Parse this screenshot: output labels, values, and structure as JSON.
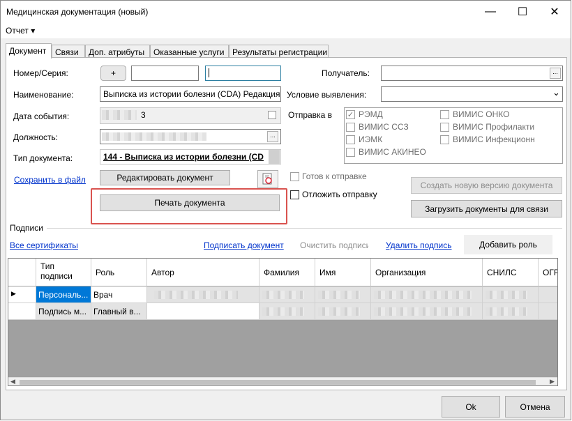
{
  "window": {
    "title": "Медицинская документация (новый)",
    "minimize": "—",
    "maximize": "☐",
    "close": "✕"
  },
  "menu": {
    "report": "Отчет ▾"
  },
  "tabs": [
    {
      "label": "Документ"
    },
    {
      "label": "Связи"
    },
    {
      "label": "Доп. атрибуты"
    },
    {
      "label": "Оказанные услуги"
    },
    {
      "label": "Результаты регистрации"
    }
  ],
  "form": {
    "number_label": "Номер/Серия:",
    "plus_label": "+",
    "number_value": "",
    "series_value": "",
    "name_label": "Наименование:",
    "name_value": "Выписка из истории болезни (CDA) Редакция",
    "event_date_label": "Дата события:",
    "event_date_value": "3",
    "position_label": "Должность:",
    "doc_type_label": "Тип документа:",
    "doc_type_value": "144 -  Выписка из истории болезни (CD",
    "recipient_label": "Получатель:",
    "recipient_value": "",
    "condition_label": "Условие выявления:",
    "condition_value": "",
    "send_to_label": "Отправка в"
  },
  "send_to": [
    {
      "label": "РЭМД",
      "checked": true
    },
    {
      "label": "ВИМИС ССЗ",
      "checked": false
    },
    {
      "label": "ИЭМК",
      "checked": false
    },
    {
      "label": "ВИМИС АКИНЕО",
      "checked": false
    },
    {
      "label": "ВИМИС ОНКО",
      "checked": false
    },
    {
      "label": "ВИМИС Профилакти",
      "checked": false
    },
    {
      "label": "ВИМИС Инфекционн",
      "checked": false
    }
  ],
  "actions": {
    "save_to_file": "Сохранить в файл",
    "edit_document": "Редактировать документ",
    "print_document": "Печать документа",
    "ready_to_send": "Готов к отправке",
    "postpone_send": "Отложить отправку",
    "create_new_version": "Создать новую версию документа",
    "load_documents": "Загрузить документы для связи"
  },
  "signatures": {
    "group_label": "Подписи",
    "all_certificates": "Все сертификаты",
    "sign_document": "Подписать документ",
    "clear_signatures": "Очистить подписи",
    "delete_signature": "Удалить подпись",
    "add_role": "Добавить роль",
    "columns": [
      "Тип подписи",
      "Роль",
      "Автор",
      "Фамилия",
      "Имя",
      "Организация",
      "СНИЛС",
      "ОГР"
    ],
    "rows": [
      {
        "type": "Персональ...",
        "role": "Врач",
        "current": true
      },
      {
        "type": "Подпись м...",
        "role": "Главный в...",
        "current": false
      }
    ]
  },
  "footer": {
    "ok": "Ok",
    "cancel": "Отмена"
  },
  "colors": {
    "accent": "#0078d7",
    "link": "#0033cc",
    "highlight": "#d9534f"
  }
}
